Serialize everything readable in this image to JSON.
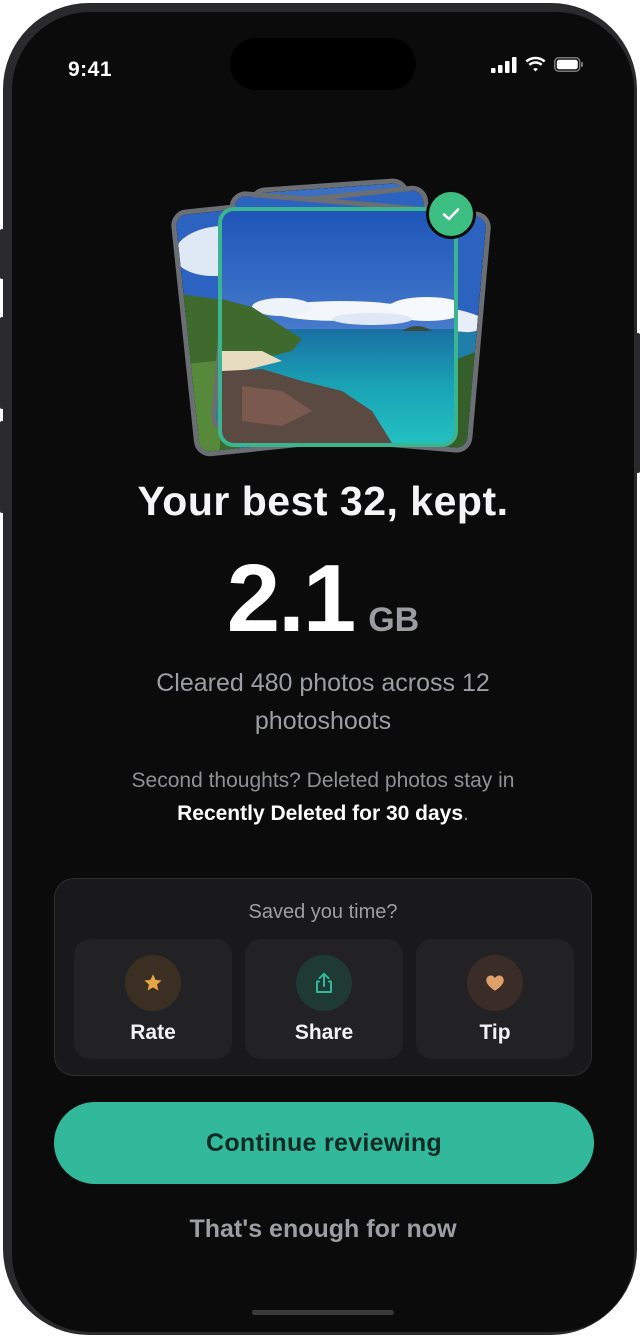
{
  "status_bar": {
    "time": "9:41",
    "icons": [
      "cellular-icon",
      "wifi-icon",
      "battery-icon"
    ]
  },
  "hero": {
    "check_icon": "check-icon",
    "accent": "#3bb58f"
  },
  "summary": {
    "headline": "Your best 32, kept.",
    "amount": "2.1",
    "unit": "GB",
    "cleared_text": "Cleared 480 photos across 12 photoshoots",
    "note_prefix": "Second thoughts? Deleted photos stay in",
    "note_bold": "Recently Deleted for 30 days",
    "note_suffix": "."
  },
  "feedback": {
    "title": "Saved you time?",
    "actions": [
      {
        "label": "Rate",
        "icon": "star-icon",
        "color": "#e7a543"
      },
      {
        "label": "Share",
        "icon": "share-icon",
        "color": "#32b99b"
      },
      {
        "label": "Tip",
        "icon": "heart-icon",
        "color": "#e0a06a"
      }
    ]
  },
  "buttons": {
    "primary": "Continue reviewing",
    "secondary": "That's enough for now",
    "primary_color": "#32b99b"
  }
}
